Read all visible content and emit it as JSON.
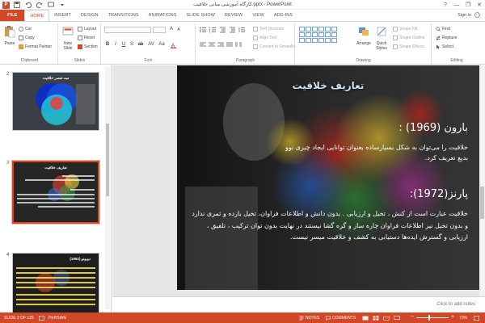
{
  "window": {
    "title": "کارگاه آموزشی مبانی خلاقیت.pptx - PowerPoint",
    "controls": [
      "?",
      "—",
      "❐",
      "✕"
    ]
  },
  "tabs": [
    "FILE",
    "HOME",
    "INSERT",
    "DESIGN",
    "TRANSITIONS",
    "ANIMATIONS",
    "SLIDE SHOW",
    "REVIEW",
    "VIEW",
    "ADD-INS"
  ],
  "active_tab": "HOME",
  "account": {
    "sign_in": "Sign in"
  },
  "ribbon": {
    "clipboard": {
      "label": "Clipboard",
      "paste": "Paste",
      "cut": "Cut",
      "copy": "Copy",
      "format_painter": "Format Painter"
    },
    "slides": {
      "label": "Slides",
      "new_slide": "New Slide",
      "layout": "Layout",
      "reset": "Reset",
      "section": "Section"
    },
    "font": {
      "label": "Font",
      "font_name": "",
      "font_size": "",
      "buttons": [
        "B",
        "I",
        "U",
        "S",
        "ab",
        "AV",
        "Aa",
        "A",
        "A"
      ]
    },
    "paragraph": {
      "label": "Paragraph",
      "text_direction": "Text Direction",
      "align_text": "Align Text",
      "convert_smartart": "Convert to SmartArt"
    },
    "drawing": {
      "label": "Drawing",
      "arrange": "Arrange",
      "quick_styles": "Quick Styles",
      "shape_fill": "Shape Fill",
      "shape_outline": "Shape Outline",
      "shape_effects": "Shape Effects"
    },
    "editing": {
      "label": "Editing",
      "find": "Find",
      "replace": "Replace",
      "select": "Select"
    }
  },
  "thumbnails": [
    {
      "number": "2",
      "title": "سه عنصر خلاقیت",
      "selected": false
    },
    {
      "number": "3",
      "title": "تعاریف خلاقیت",
      "selected": true
    },
    {
      "number": "4",
      "title": "دوبونو (1962)",
      "selected": false
    }
  ],
  "slide": {
    "title": "تعاریف خلاقیت",
    "heading1": "بارون (1969) :",
    "body1": "خلاقیت را می‌توان به شکل بسیارساده بعنوان توانایی ایجاد چیزی نوو بدیع تعریف کرد.",
    "heading2": "پارنز(1972):",
    "body2": "خلاقیت عبارت است از کنش ، تخیل و ارزیابی . بدون دانش و اطلاعات فراوان، تخیل بازده و ثمری ندارد و بدون تخیل نیز اطلاعات فراوان چاره ساز و گره گشا نیستند در نهایت بدون توان ترکیب ، تلفیق ، ارزیابی و گسترش ایده‌ها دستیابی به کشف و خلاقیت میسر نیست."
  },
  "notes": {
    "placeholder": "Click to add notes"
  },
  "status": {
    "slide_info": "SLIDE 3 OF 125",
    "language": "PERSIAN",
    "notes": "NOTES",
    "comments": "COMMENTS",
    "zoom": "70%"
  },
  "colors": {
    "accent": "#d24726",
    "slide_title": "#cfe3f7"
  }
}
